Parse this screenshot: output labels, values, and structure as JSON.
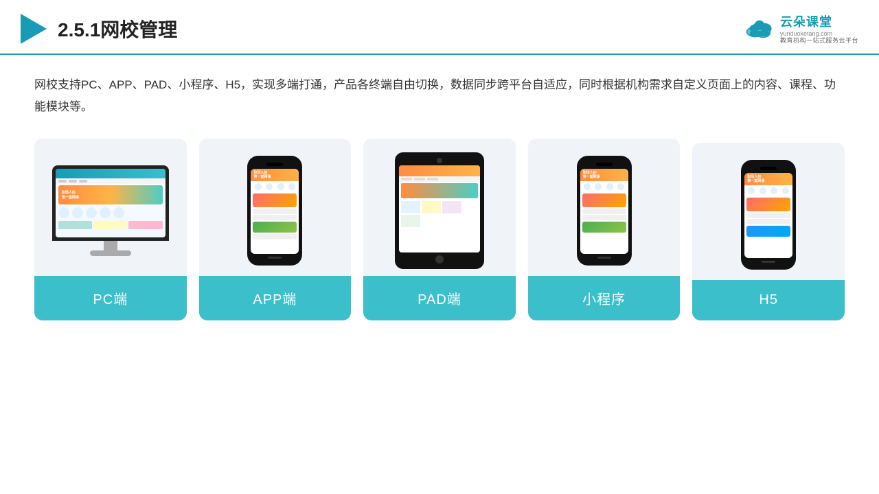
{
  "header": {
    "title": "2.5.1网校管理",
    "brand": {
      "name": "云朵课堂",
      "url": "yunduoketang.com",
      "tagline": "教育机构一站\n式服务云平台"
    }
  },
  "description": "网校支持PC、APP、PAD、小程序、H5，实现多端打通，产品各终端自由切换，数据同步跨平台自适应，同时根据机构需求自定义页面上的内容、课程、功能模块等。",
  "cards": [
    {
      "label": "PC端",
      "type": "pc"
    },
    {
      "label": "APP端",
      "type": "phone"
    },
    {
      "label": "PAD端",
      "type": "tablet"
    },
    {
      "label": "小程序",
      "type": "mini-phone"
    },
    {
      "label": "H5",
      "type": "mini-phone-2"
    }
  ],
  "colors": {
    "accent": "#1a9bb5",
    "card_bg": "#f0f4f8",
    "label_bg": "#3bbfca",
    "label_text": "#ffffff"
  }
}
